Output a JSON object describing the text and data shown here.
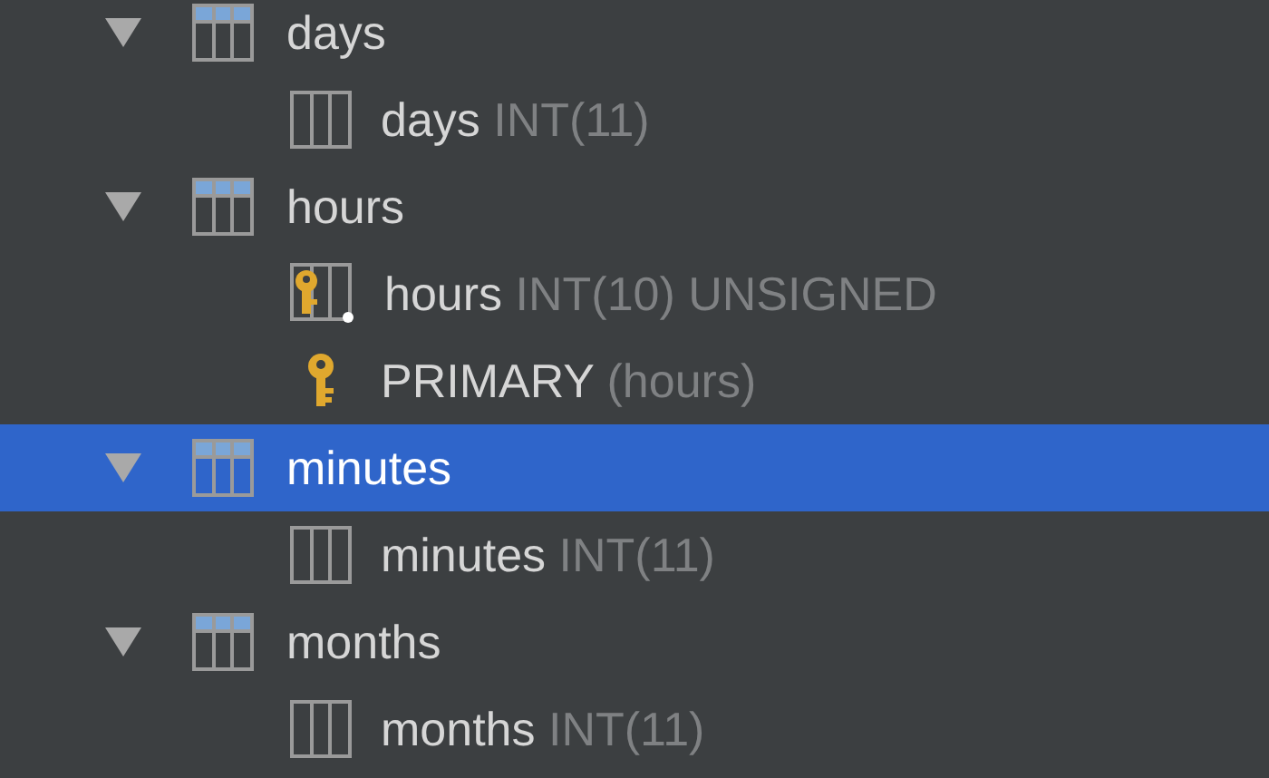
{
  "tree": [
    {
      "name": "days",
      "expanded": true,
      "selected": false,
      "children": [
        {
          "kind": "column",
          "name": "days",
          "detail": "INT(11)"
        }
      ]
    },
    {
      "name": "hours",
      "expanded": true,
      "selected": false,
      "children": [
        {
          "kind": "key-column",
          "name": "hours",
          "detail": "INT(10) UNSIGNED"
        },
        {
          "kind": "index",
          "name": "PRIMARY",
          "detail": "(hours)"
        }
      ]
    },
    {
      "name": "minutes",
      "expanded": true,
      "selected": true,
      "children": [
        {
          "kind": "column",
          "name": "minutes",
          "detail": "INT(11)"
        }
      ]
    },
    {
      "name": "months",
      "expanded": true,
      "selected": false,
      "children": [
        {
          "kind": "column",
          "name": "months",
          "detail": "INT(11)"
        }
      ]
    }
  ]
}
